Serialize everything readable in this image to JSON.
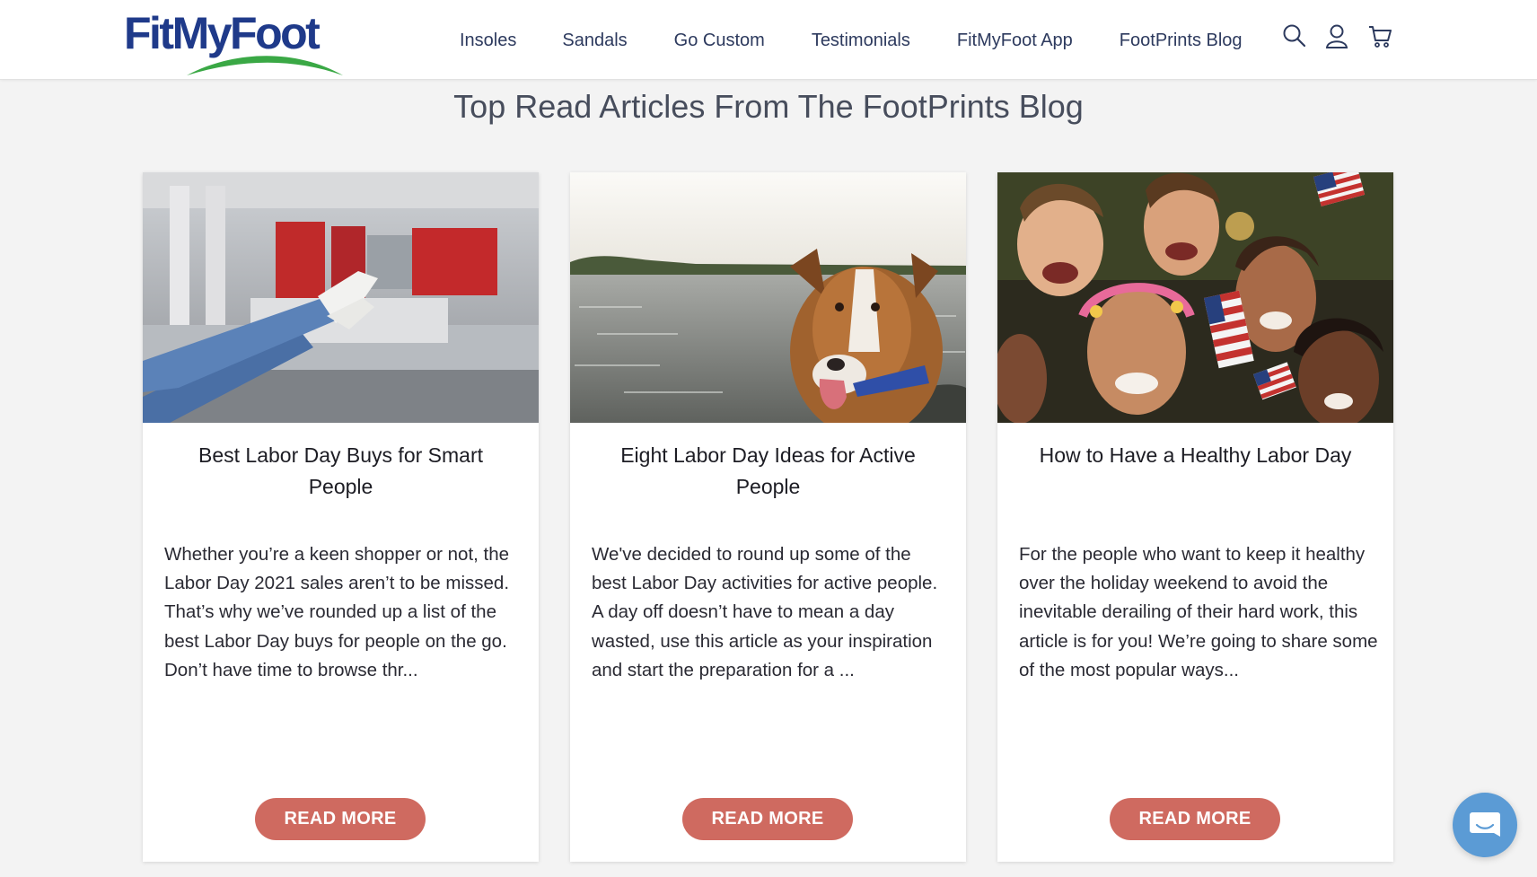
{
  "header": {
    "logo_text": "FitMyFoot",
    "nav": [
      {
        "label": "Insoles"
      },
      {
        "label": "Sandals"
      },
      {
        "label": "Go Custom"
      },
      {
        "label": "Testimonials"
      },
      {
        "label": "FitMyFoot App"
      },
      {
        "label": "FootPrints Blog"
      }
    ],
    "icons": [
      "search-icon",
      "account-icon",
      "cart-icon"
    ]
  },
  "section": {
    "title": "Top Read Articles From The FootPrints Blog"
  },
  "articles": [
    {
      "title": "Best Labor Day Buys for Smart People",
      "excerpt": "Whether you’re a keen shopper or not, the Labor Day 2021 sales aren’t to be missed. That’s why we’ve rounded up a list of the best Labor Day buys for people on the go. Don’t have time to browse thr...",
      "button": "READ MORE",
      "image": "legs-in-jeans-mattress-store"
    },
    {
      "title": "Eight Labor Day Ideas for Active People",
      "excerpt": "We've decided to round up some of the best Labor Day activities for active people. A day off doesn’t have to mean a day wasted, use this article as your inspiration and start the preparation for a ...",
      "button": "READ MORE",
      "image": "dog-on-boat-by-lake"
    },
    {
      "title": "How to Have a Healthy Labor Day",
      "excerpt": "For the people who want to keep it healthy over the holiday weekend to avoid the inevitable derailing of their hard work, this article is for you! We’re going to share some of the most popular ways...",
      "button": "READ MORE",
      "image": "friends-celebrating-with-flags"
    }
  ],
  "colors": {
    "brand_blue": "#1f3a8a",
    "brand_green": "#3aa845",
    "button": "#cf6a60",
    "chat": "#5b9bd5"
  },
  "chat": {
    "icon": "chat-icon"
  }
}
